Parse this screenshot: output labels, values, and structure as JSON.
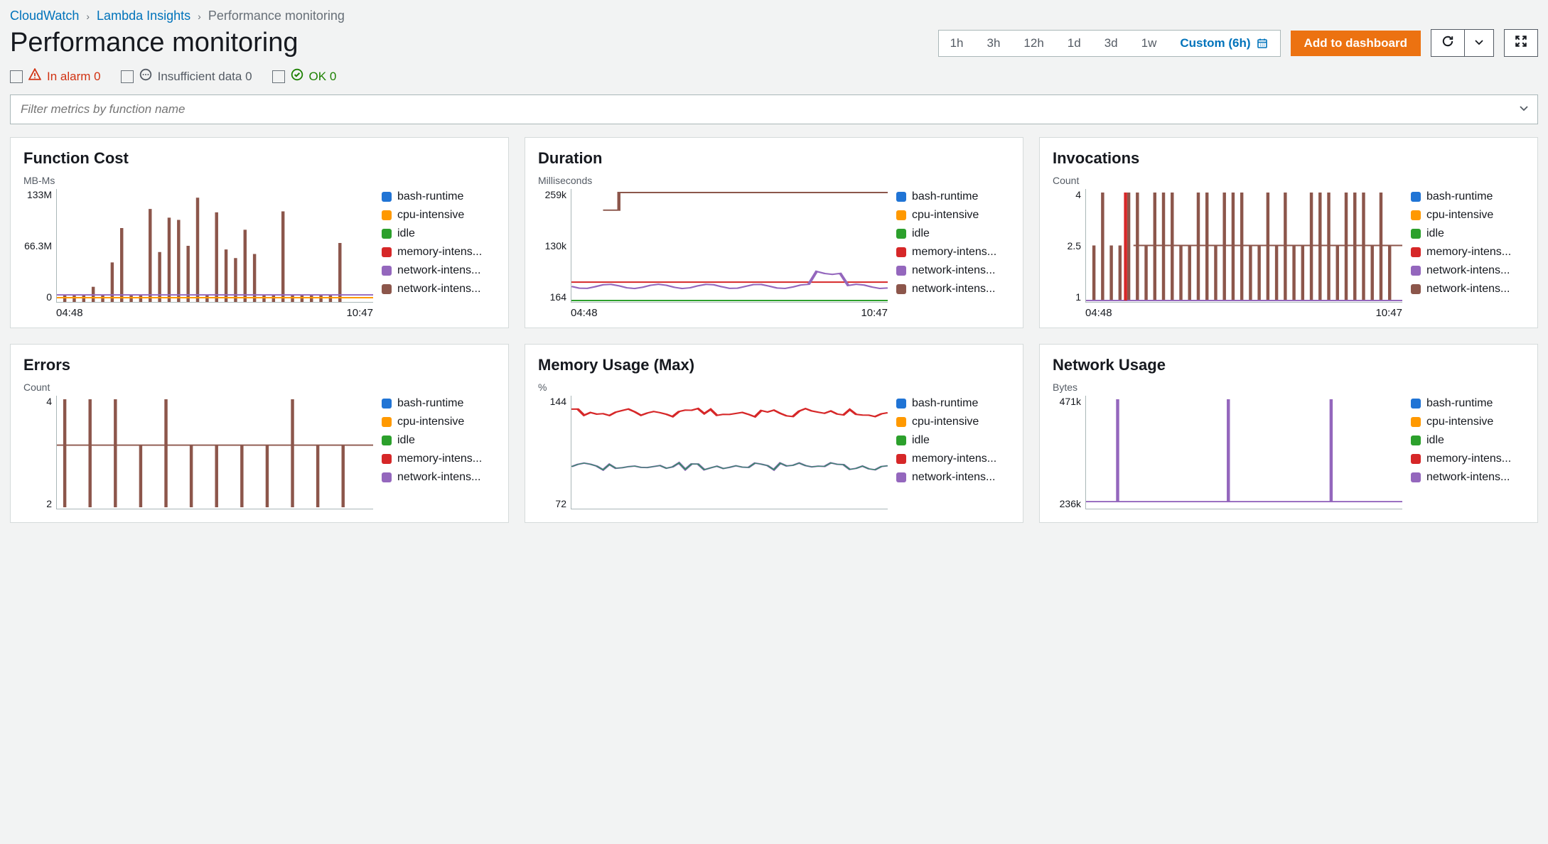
{
  "breadcrumb": {
    "root": "CloudWatch",
    "mid": "Lambda Insights",
    "current": "Performance monitoring"
  },
  "title": "Performance monitoring",
  "time_range": {
    "options": [
      "1h",
      "3h",
      "12h",
      "1d",
      "3d",
      "1w"
    ],
    "custom_label": "Custom (6h)"
  },
  "actions": {
    "add_dashboard": "Add to dashboard"
  },
  "status": {
    "alarm_label": "In alarm 0",
    "insufficient_label": "Insufficient data 0",
    "ok_label": "OK 0"
  },
  "filter": {
    "placeholder": "Filter metrics by function name"
  },
  "legend_colors": {
    "bash-runtime": "#2074d5",
    "cpu-intensive": "#ff9900",
    "idle": "#2ca02c",
    "memory-intens...": "#d62728",
    "network-intens...": "#9467bd",
    "network-intens2...": "#8c564b"
  },
  "legend_series": [
    "bash-runtime",
    "cpu-intensive",
    "idle",
    "memory-intens...",
    "network-intens...",
    "network-intens..."
  ],
  "panels": [
    {
      "title": "Function Cost",
      "unit": "MB-Ms",
      "y_ticks": [
        "133M",
        "66.3M",
        "0"
      ],
      "x_ticks": [
        "04:48",
        "10:47"
      ]
    },
    {
      "title": "Duration",
      "unit": "Milliseconds",
      "y_ticks": [
        "259k",
        "130k",
        "164"
      ],
      "x_ticks": [
        "04:48",
        "10:47"
      ]
    },
    {
      "title": "Invocations",
      "unit": "Count",
      "y_ticks": [
        "4",
        "2.5",
        "1"
      ],
      "x_ticks": [
        "04:48",
        "10:47"
      ]
    },
    {
      "title": "Errors",
      "unit": "Count",
      "y_ticks": [
        "4",
        "2"
      ],
      "x_ticks": []
    },
    {
      "title": "Memory Usage (Max)",
      "unit": "%",
      "y_ticks": [
        "144",
        "72"
      ],
      "x_ticks": []
    },
    {
      "title": "Network Usage",
      "unit": "Bytes",
      "y_ticks": [
        "471k",
        "236k"
      ],
      "x_ticks": []
    }
  ],
  "chart_data": [
    {
      "type": "line",
      "title": "Function Cost",
      "ylabel": "MB-Ms",
      "ylim": [
        0,
        133000000
      ],
      "x_range": [
        "04:48",
        "10:47"
      ],
      "series": [
        {
          "name": "bash-runtime",
          "baseline": 8000000
        },
        {
          "name": "cpu-intensive",
          "baseline": 9000000
        },
        {
          "name": "idle",
          "baseline": 4000000
        },
        {
          "name": "memory-intens...",
          "baseline": 7000000
        },
        {
          "name": "network-intens...",
          "baseline": 10000000
        },
        {
          "name": "network-intens...",
          "baseline": 12000000,
          "spikes_to": 133000000,
          "spike_count": 25
        }
      ]
    },
    {
      "type": "line",
      "title": "Duration",
      "ylabel": "Milliseconds",
      "ylim": [
        164,
        259000
      ],
      "x_range": [
        "04:48",
        "10:47"
      ],
      "series": [
        {
          "name": "bash-runtime",
          "baseline": 2000
        },
        {
          "name": "cpu-intensive",
          "baseline": 3000
        },
        {
          "name": "idle",
          "baseline": 164
        },
        {
          "name": "memory-intens...",
          "baseline": 20000
        },
        {
          "name": "network-intens...",
          "baseline": 22000,
          "spikes_to": 60000,
          "spike_count": 3
        },
        {
          "name": "network-intens...",
          "baseline": 259000,
          "step_at": 0.1,
          "initial": 200000
        }
      ]
    },
    {
      "type": "line",
      "title": "Invocations",
      "ylabel": "Count",
      "ylim": [
        1,
        4
      ],
      "x_range": [
        "04:48",
        "10:47"
      ],
      "series": [
        {
          "name": "bash-runtime",
          "baseline": 1
        },
        {
          "name": "cpu-intensive",
          "baseline": 1
        },
        {
          "name": "idle",
          "baseline": 1
        },
        {
          "name": "memory-intens...",
          "baseline": 1,
          "spikes_to": 4,
          "spike_count": 2
        },
        {
          "name": "network-intens...",
          "baseline": 1
        },
        {
          "name": "network-intens...",
          "baseline": 2.5,
          "spikes_to": 4,
          "spike_count": 30
        }
      ]
    },
    {
      "type": "line",
      "title": "Errors",
      "ylabel": "Count",
      "ylim": [
        0,
        4
      ],
      "x_range": [
        "04:48",
        "10:47"
      ],
      "series": [
        {
          "name": "network-intens...",
          "baseline": 2,
          "spikes_to": 4,
          "spike_count": 10
        }
      ]
    },
    {
      "type": "line",
      "title": "Memory Usage (Max)",
      "ylabel": "%",
      "ylim": [
        0,
        144
      ],
      "x_range": [
        "04:48",
        "10:47"
      ],
      "series": [
        {
          "name": "bash-runtime",
          "baseline": 70
        },
        {
          "name": "cpu-intensive",
          "baseline": 72
        },
        {
          "name": "idle",
          "baseline": 68
        },
        {
          "name": "memory-intens...",
          "baseline": 140,
          "noise": 8
        },
        {
          "name": "network-intens...",
          "baseline": 75
        },
        {
          "name": "network-intens...",
          "baseline": 73
        }
      ]
    },
    {
      "type": "line",
      "title": "Network Usage",
      "ylabel": "Bytes",
      "ylim": [
        0,
        471000
      ],
      "x_range": [
        "04:48",
        "10:47"
      ],
      "series": [
        {
          "name": "network-intens...",
          "baseline": 10000,
          "spikes_to": 471000,
          "spike_count": 3
        }
      ]
    }
  ]
}
